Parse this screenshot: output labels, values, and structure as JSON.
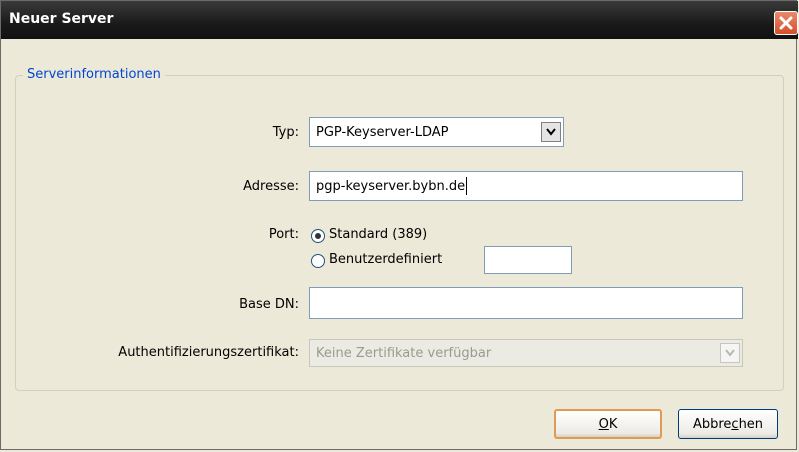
{
  "window": {
    "title": "Neuer Server"
  },
  "icons": {
    "close": "close-x-icon",
    "combo": "chevron-down-icon"
  },
  "group": {
    "legend": "Serverinformationen"
  },
  "fields": {
    "type_label": "Typ:",
    "type_value": "PGP-Keyserver-LDAP",
    "address_label": "Adresse:",
    "address_value": "pgp-keyserver.bybn.de",
    "port_label": "Port:",
    "port_standard_label": "Standard (389)",
    "port_standard_selected": true,
    "port_custom_label": "Benutzerdefiniert",
    "port_custom_value": "",
    "basedn_label": "Base DN:",
    "basedn_value": "",
    "cert_label": "Authentifizierungszertifikat:",
    "cert_value": "Keine Zertifikate verfügbar"
  },
  "buttons": {
    "ok_mnemonic": "O",
    "ok_rest": "K",
    "cancel_prefix": "Abbre",
    "cancel_mnemonic": "c",
    "cancel_suffix": "hen"
  },
  "colors": {
    "legend": "#0046d5",
    "default_button_border": "#e09b52",
    "close": "#d4502a"
  }
}
